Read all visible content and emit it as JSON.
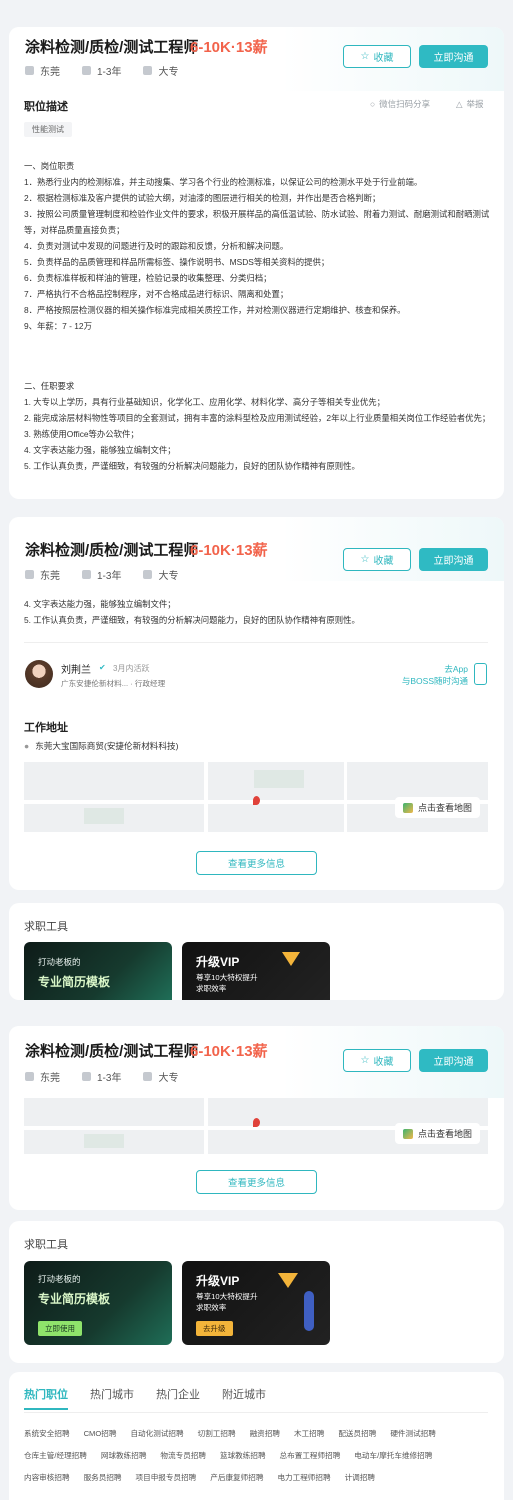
{
  "job": {
    "title": "涂料检测/质检/测试工程师",
    "salary": "6-10K·13薪",
    "city": "东莞",
    "experience": "1-3年",
    "education": "大专",
    "fav_label": "收藏",
    "chat_label": "立即沟通"
  },
  "description": {
    "heading": "职位描述",
    "share": "微信扫码分享",
    "report": "举报",
    "tag": "性能测试",
    "duties_title": "一、岗位职责",
    "duties": [
      "1．熟悉行业内的检测标准，并主动搜集、学习各个行业的检测标准，以保证公司的检测水平处于行业前端。",
      "2．根据检测标准及客户提供的试验大纲，对油漆的图层进行相关的检测，并作出是否合格判断；",
      "3．按照公司质量管理制度和检验作业文件的要求，积极开展样品的高低温试验、防水试验、附着力测试、耐磨测试和耐晒测试等，对样品质量直接负责；",
      "4．负责对测试中发现的问题进行及时的跟踪和反馈，分析和解决问题。",
      "5．负责样品的品质管理和样品所需标签、操作说明书、MSDS等相关资料的提供；",
      "6．负责标准样板和样油的管理，检验记录的收集整理、分类归档；",
      "7．严格执行不合格品控制程序，对不合格成品进行标识、隔离和处置；",
      "8．严格按照层检测仪器的相关操作标准完成相关质控工作，并对检测仪器进行定期维护、核查和保养。",
      "9、年薪：7 - 12万"
    ],
    "req_title": "二、任职要求",
    "requirements": [
      "1. 大专以上学历，具有行业基础知识，化学化工、应用化学、材料化学、高分子等相关专业优先；",
      "2. 能完成涂层材料物性等项目的全套测试，拥有丰富的涂料型检及应用测试经验，2年以上行业质量相关岗位工作经验者优先；",
      "3. 熟练使用Office等办公软件；",
      "4. 文字表达能力强，能够独立编制文件；",
      "5. 工作认真负责，严谨细致，有较强的分析解决问题能力，良好的团队协作精神有原则性。"
    ]
  },
  "recruiter": {
    "name": "刘荆兰",
    "active": "3月内活跃",
    "company": "广东安捷伦新材料...",
    "role": "行政经理",
    "app_line1": "去App",
    "app_line2": "与BOSS随时沟通"
  },
  "address": {
    "heading": "工作地址",
    "text": "东莞大宝国际商贸(安捷伦新材料科技)",
    "map_btn": "点击查看地图",
    "more": "查看更多信息"
  },
  "tools": {
    "heading": "求职工具",
    "card1_line1": "打动老板的",
    "card1_line2": "专业简历模板",
    "card1_btn": "立即使用",
    "card2_title": "升级VIP",
    "card2_line1": "尊享10大特权提升",
    "card2_line2": "求职效率",
    "card2_btn": "去升级"
  },
  "hot": {
    "tabs": [
      "热门职位",
      "热门城市",
      "热门企业",
      "附近城市"
    ],
    "links": [
      "系统安全招聘",
      "CMO招聘",
      "自动化测试招聘",
      "切割工招聘",
      "融资招聘",
      "木工招聘",
      "配送员招聘",
      "硬件测试招聘",
      "仓库主管/经理招聘",
      "网球教练招聘",
      "物流专员招聘",
      "篮球教练招聘",
      "总布置工程师招聘",
      "电动车/摩托车维修招聘",
      "内容审核招聘",
      "服务员招聘",
      "项目申报专员招聘",
      "产后康复师招聘",
      "电力工程师招聘",
      "计调招聘"
    ]
  },
  "colors": {
    "accent": "#2fbac3",
    "salary": "#f2634b"
  }
}
